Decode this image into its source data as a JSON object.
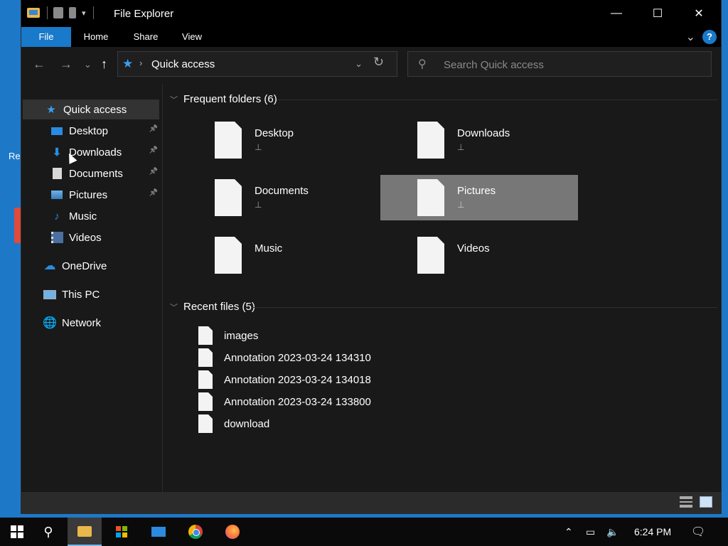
{
  "window": {
    "title": "File Explorer",
    "minimize_glyph": "—",
    "maximize_glyph": "☐",
    "close_glyph": "✕"
  },
  "ribbon": {
    "tabs": [
      "File",
      "Home",
      "Share",
      "View"
    ],
    "help_glyph": "?",
    "expand_glyph": "⌄"
  },
  "nav": {
    "back_glyph": "←",
    "forward_glyph": "→",
    "recent_glyph": "⌄",
    "up_glyph": "↑",
    "address": {
      "icon": "quick-access-star-icon",
      "separator": "›",
      "location": "Quick access",
      "dropdown_glyph": "⌄"
    },
    "refresh_glyph": "↻",
    "search": {
      "placeholder": "Search Quick access",
      "value": ""
    }
  },
  "sidebar": {
    "items": [
      {
        "label": "Quick access",
        "icon": "star-icon",
        "pinned": false,
        "selected": true
      },
      {
        "label": "Desktop",
        "icon": "desktop-icon",
        "pinned": true
      },
      {
        "label": "Downloads",
        "icon": "download-arrow-icon",
        "pinned": true
      },
      {
        "label": "Documents",
        "icon": "documents-icon",
        "pinned": true
      },
      {
        "label": "Pictures",
        "icon": "pictures-icon",
        "pinned": true
      },
      {
        "label": "Music",
        "icon": "music-note-icon",
        "pinned": false
      },
      {
        "label": "Videos",
        "icon": "film-icon",
        "pinned": false
      },
      {
        "label": "OneDrive",
        "icon": "cloud-icon",
        "pinned": false
      },
      {
        "label": "This PC",
        "icon": "computer-icon",
        "pinned": false
      },
      {
        "label": "Network",
        "icon": "network-icon",
        "pinned": false
      }
    ],
    "pin_glyph": "📌"
  },
  "main": {
    "frequent": {
      "header": "Frequent folders (6)",
      "folders": [
        {
          "name": "Desktop",
          "pinned": true
        },
        {
          "name": "Downloads",
          "pinned": true
        },
        {
          "name": "Documents",
          "pinned": true
        },
        {
          "name": "Pictures",
          "pinned": true,
          "selected": true
        },
        {
          "name": "Music",
          "pinned": false
        },
        {
          "name": "Videos",
          "pinned": false
        }
      ]
    },
    "recent": {
      "header": "Recent files (5)",
      "files": [
        "images",
        "Annotation 2023-03-24 134310",
        "Annotation 2023-03-24 134018",
        "Annotation 2023-03-24 133800",
        "download"
      ]
    }
  },
  "taskbar": {
    "clock": "6:24 PM",
    "apps": [
      "start-icon",
      "search-icon",
      "file-explorer-icon",
      "store-icon",
      "mail-icon",
      "chrome-icon",
      "firefox-icon"
    ]
  },
  "desktop": {
    "fragments": [
      "Re"
    ]
  },
  "colors": {
    "accent": "#1979ca",
    "selected_tile": "#777777",
    "background": "#191919"
  }
}
